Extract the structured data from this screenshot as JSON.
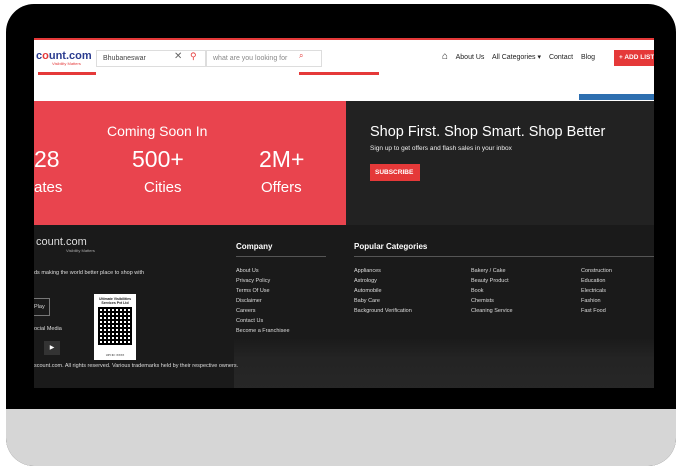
{
  "header": {
    "logo_main": "c",
    "logo_accent": "o",
    "logo_rest": "unt.com",
    "logo_tagline": "Visibility Matters",
    "location_value": "Bhubaneswar",
    "search_placeholder": "what are you looking for",
    "nav": [
      "About Us",
      "All Categories ▾",
      "Contact",
      "Blog"
    ],
    "add_button": "+ ADD LIST"
  },
  "banner": {
    "coming_soon": "Coming Soon In",
    "stats": [
      {
        "value": "28",
        "label": "ates"
      },
      {
        "value": "500+",
        "label": "Cities"
      },
      {
        "value": "2M+",
        "label": "Offers"
      }
    ],
    "shop_title": "Shop First. Shop Smart. Shop Better",
    "shop_subtitle": "Sign up to get offers and flash sales in your inbox",
    "subscribe_label": "SUBSCRIBE"
  },
  "footer": {
    "logo_text": "count.com",
    "logo_tagline": "Visibility Matters",
    "tagline": "ds making the world better place to shop with",
    "play_label": "Play",
    "social_label": "ocial Media",
    "qr_title": "Ultimate Visibilities Services Pvt Ltd",
    "qr_caption": "UPI ID: XXXX",
    "copyright": "scount.com. All rights reserved. Various trademarks held by their respective owners.",
    "company_heading": "Company",
    "company_links": [
      "About Us",
      "Privacy Policy",
      "Terms Of Use",
      "Disclaimer",
      "Careers",
      "Contact Us",
      "Become a Franchisee"
    ],
    "categories_heading": "Popular Categories",
    "categories_col1": [
      "Appliances",
      "Astrology",
      "Automobile",
      "Baby Care",
      "Background Verification"
    ],
    "categories_col2": [
      "Bakery / Cake",
      "Beauty Product",
      "Book",
      "Chemists",
      "Cleaning Service"
    ],
    "categories_col3": [
      "Construction",
      "Education",
      "Electricals",
      "Fashion",
      "Fast Food"
    ]
  }
}
